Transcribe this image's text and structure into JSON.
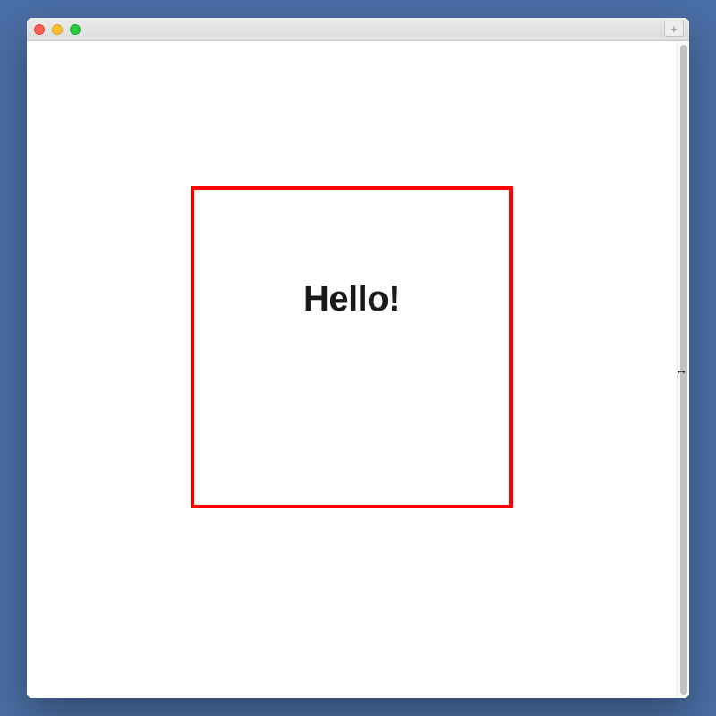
{
  "window": {
    "traffic_lights": {
      "close": "close",
      "minimize": "minimize",
      "maximize": "maximize"
    },
    "add_tab_label": "+"
  },
  "content": {
    "box_text": "Hello!",
    "box_border_color": "#ff0000"
  },
  "cursor": {
    "glyph": "↔"
  }
}
